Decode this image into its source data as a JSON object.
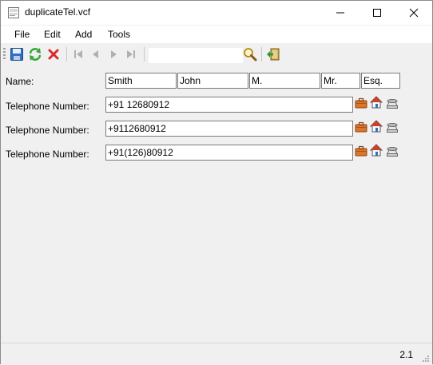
{
  "window": {
    "title": "duplicateTel.vcf"
  },
  "menu": [
    "File",
    "Edit",
    "Add",
    "Tools"
  ],
  "toolbar": {
    "search_value": ""
  },
  "name_row": {
    "label": "Name:",
    "last": "Smith",
    "first": "John",
    "middle": "M.",
    "prefix": "Mr.",
    "suffix": "Esq."
  },
  "phones": [
    {
      "label": "Telephone Number:",
      "value": "+91 12680912"
    },
    {
      "label": "Telephone Number:",
      "value": "+9112680912"
    },
    {
      "label": "Telephone Number:",
      "value": "+91(126)80912"
    }
  ],
  "status": {
    "version": "2.1"
  },
  "icons": [
    "save-icon",
    "refresh-icon",
    "delete-icon",
    "first-record-icon",
    "previous-record-icon",
    "next-record-icon",
    "last-record-icon",
    "search-icon",
    "exit-icon",
    "work-briefcase-icon",
    "home-icon",
    "phone-icon"
  ],
  "colors": {
    "save_blue": "#2f6fc4",
    "refresh_green": "#3aa63a",
    "delete_red": "#d92b2b",
    "briefcase_orange": "#d9762a",
    "home_red": "#d13d2b"
  }
}
